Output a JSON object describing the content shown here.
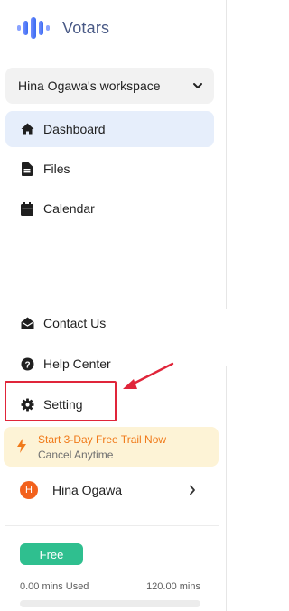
{
  "brand": {
    "name": "Votars",
    "color": "#4a5a86"
  },
  "workspace": {
    "name": "Hina Ogawa's workspace"
  },
  "nav_top": [
    {
      "label": "Dashboard",
      "icon": "home-icon",
      "active": true
    },
    {
      "label": "Files",
      "icon": "file-icon",
      "active": false
    },
    {
      "label": "Calendar",
      "icon": "calendar-icon",
      "active": false
    }
  ],
  "nav_bottom": [
    {
      "label": "Contact Us",
      "icon": "mail-icon"
    },
    {
      "label": "Help Center",
      "icon": "help-icon"
    },
    {
      "label": "Setting",
      "icon": "gear-icon"
    }
  ],
  "trial": {
    "title": "Start 3-Day Free Trail Now",
    "subtitle": "Cancel Anytime",
    "accent": "#f07a1a"
  },
  "user": {
    "initial": "H",
    "name": "Hina Ogawa",
    "avatar_color": "#f2611c"
  },
  "plan": {
    "badge": "Free",
    "used": "0.00 mins Used",
    "total": "120.00 mins",
    "used_fraction": 0,
    "color": "#2fbf8f"
  },
  "annotation": {
    "highlight_color": "#e0253a",
    "highlighted_item": "Setting"
  }
}
